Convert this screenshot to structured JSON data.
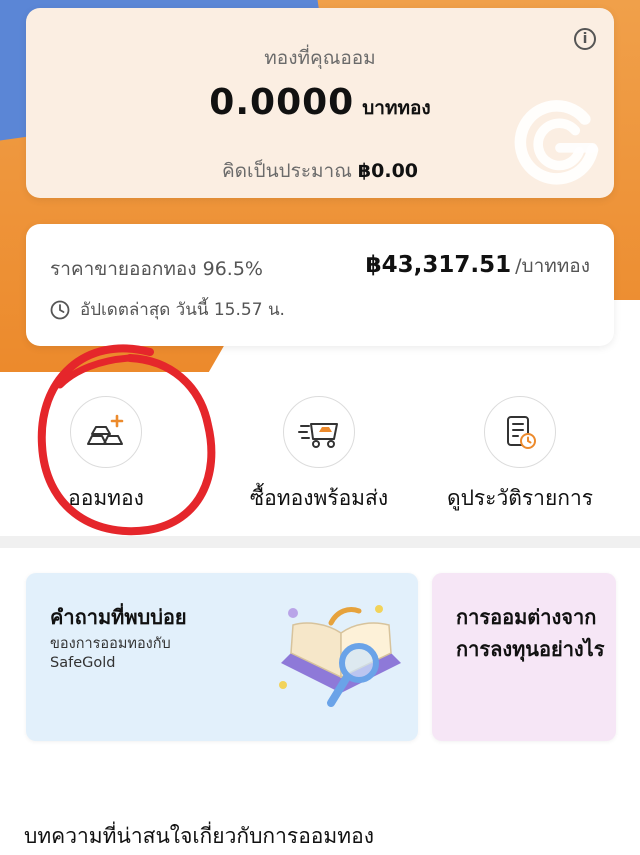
{
  "savings": {
    "label": "ทองที่คุณออม",
    "amount": "0.0000",
    "unit": "บาททอง",
    "approx_label": "คิดเป็นประมาณ",
    "approx_value": "฿0.00",
    "info_icon": "info-icon",
    "logo_icon": "safegold-logo-icon"
  },
  "price": {
    "label": "ราคาขายออกทอง 96.5%",
    "value": "฿43,317.51",
    "unit": "/บาททอง",
    "updated": "อัปเดตล่าสุด วันนี้ 15.57 น."
  },
  "actions": [
    {
      "label": "ออมทอง",
      "icon": "gold-bar-add-icon"
    },
    {
      "label": "ซื้อทองพร้อมส่ง",
      "icon": "delivery-cart-icon"
    },
    {
      "label": "ดูประวัติรายการ",
      "icon": "history-list-icon"
    }
  ],
  "cards": {
    "faq": {
      "title": "คำถามที่พบบ่อย",
      "line1": "ของการออมทองกับ",
      "line2": "SafeGold"
    },
    "diff": {
      "line1": "การออมต่างจาก",
      "line2": "การลงทุนอย่างไร"
    }
  },
  "section_title": "บทความที่น่าสนใจเกี่ยวกับการออมทอง",
  "colors": {
    "accent_orange": "#ec8a2c",
    "accent_blue": "#5b86d6",
    "annotation_red": "#e5262b",
    "faq_bg": "#e2f0fb",
    "diff_bg": "#f6e6f6"
  }
}
